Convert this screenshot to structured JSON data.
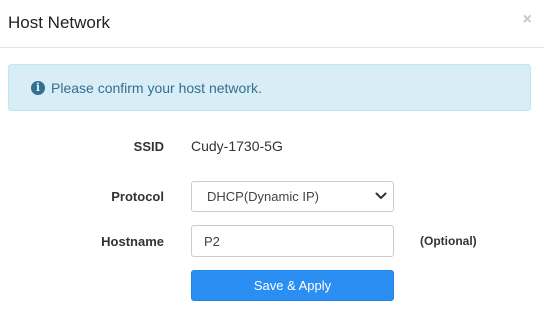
{
  "header": {
    "title": "Host Network",
    "close_label": "×"
  },
  "alert": {
    "icon": "info-circle-icon",
    "message": "Please confirm your host network."
  },
  "form": {
    "ssid": {
      "label": "SSID",
      "value": "Cudy-1730-5G"
    },
    "protocol": {
      "label": "Protocol",
      "selected": "DHCP(Dynamic IP)"
    },
    "hostname": {
      "label": "Hostname",
      "value": "P2",
      "hint": "(Optional)"
    },
    "submit_label": "Save & Apply"
  },
  "colors": {
    "alert_background": "#d9edf7",
    "alert_text": "#31708f",
    "primary_button": "#2b8ef3"
  }
}
